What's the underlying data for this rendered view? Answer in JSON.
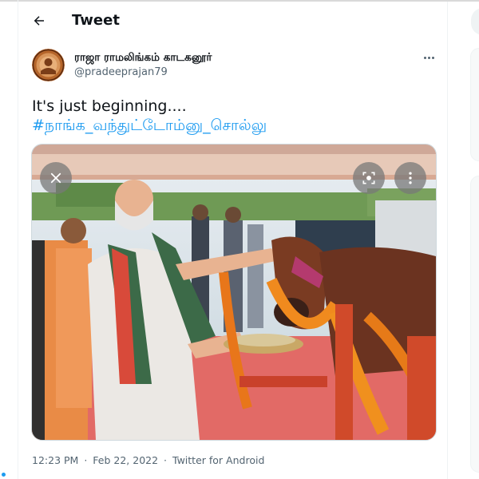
{
  "header": {
    "title": "Tweet",
    "back_icon": "arrow-left-icon"
  },
  "author": {
    "name": "ராஜா ராமலிங்கம் காடகனூர்",
    "handle": "@pradeeprajan79"
  },
  "tweet": {
    "text": "It's just beginning....",
    "hashtag": "#நாங்க_வந்துட்டோம்னு_சொல்லு"
  },
  "media": {
    "close_icon": "close-icon",
    "scan_icon": "lens-scan-icon",
    "more_icon": "more-vertical-icon"
  },
  "meta": {
    "time": "12:23 PM",
    "date": "Feb 22, 2022",
    "client": "Twitter for Android",
    "separator": "·"
  },
  "colors": {
    "accent": "#1d9bf0",
    "muted": "#536471",
    "text": "#0f1419"
  }
}
